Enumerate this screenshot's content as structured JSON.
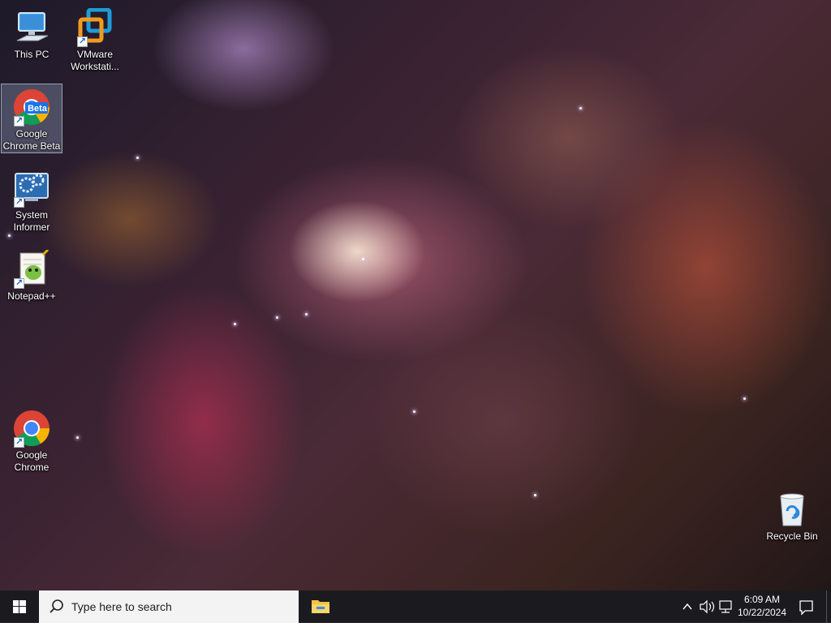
{
  "desktop": {
    "icons": [
      {
        "id": "this-pc",
        "label": "This PC"
      },
      {
        "id": "vmware",
        "label": "VMware Workstati..."
      },
      {
        "id": "chrome-beta",
        "label": "Google Chrome Beta",
        "badge": "Beta"
      },
      {
        "id": "system-informer",
        "label": "System Informer"
      },
      {
        "id": "notepadpp",
        "label": "Notepad++"
      },
      {
        "id": "chrome",
        "label": "Google Chrome"
      },
      {
        "id": "recycle-bin",
        "label": "Recycle Bin"
      }
    ]
  },
  "taskbar": {
    "search": {
      "placeholder": "Type here to search"
    },
    "clock": {
      "time": "6:09 AM",
      "date": "10/22/2024"
    },
    "colors": {
      "taskbar": "#1b1b1f",
      "search_bg": "#f3f3f3",
      "accent": "#1e90ff"
    },
    "icons": [
      "windows-logo-icon",
      "search-icon",
      "file-explorer-icon",
      "chevron-up-icon",
      "speaker-icon",
      "network-icon",
      "notification-icon"
    ]
  }
}
